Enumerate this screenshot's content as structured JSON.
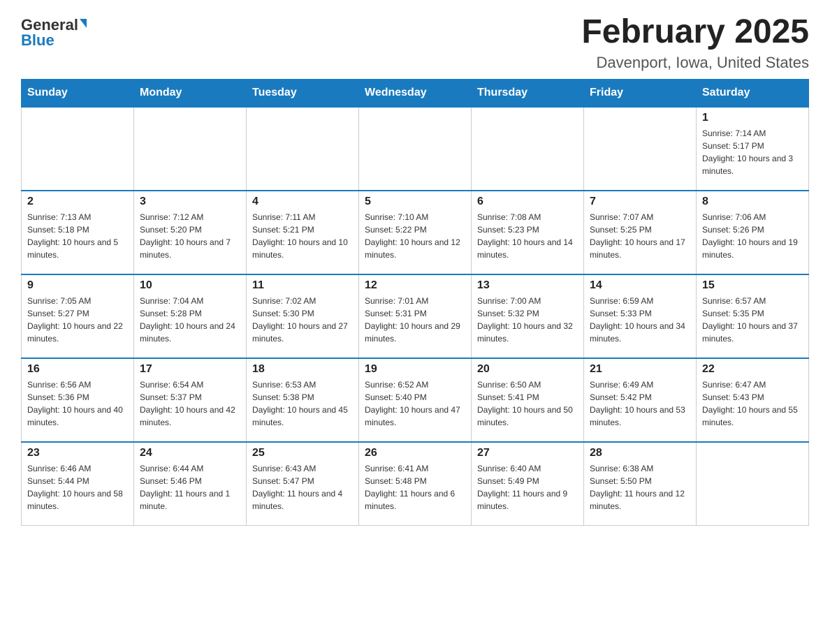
{
  "logo": {
    "general": "General",
    "blue": "Blue"
  },
  "title": "February 2025",
  "location": "Davenport, Iowa, United States",
  "days_of_week": [
    "Sunday",
    "Monday",
    "Tuesday",
    "Wednesday",
    "Thursday",
    "Friday",
    "Saturday"
  ],
  "weeks": [
    [
      {
        "day": "",
        "sunrise": "",
        "sunset": "",
        "daylight": ""
      },
      {
        "day": "",
        "sunrise": "",
        "sunset": "",
        "daylight": ""
      },
      {
        "day": "",
        "sunrise": "",
        "sunset": "",
        "daylight": ""
      },
      {
        "day": "",
        "sunrise": "",
        "sunset": "",
        "daylight": ""
      },
      {
        "day": "",
        "sunrise": "",
        "sunset": "",
        "daylight": ""
      },
      {
        "day": "",
        "sunrise": "",
        "sunset": "",
        "daylight": ""
      },
      {
        "day": "1",
        "sunrise": "Sunrise: 7:14 AM",
        "sunset": "Sunset: 5:17 PM",
        "daylight": "Daylight: 10 hours and 3 minutes."
      }
    ],
    [
      {
        "day": "2",
        "sunrise": "Sunrise: 7:13 AM",
        "sunset": "Sunset: 5:18 PM",
        "daylight": "Daylight: 10 hours and 5 minutes."
      },
      {
        "day": "3",
        "sunrise": "Sunrise: 7:12 AM",
        "sunset": "Sunset: 5:20 PM",
        "daylight": "Daylight: 10 hours and 7 minutes."
      },
      {
        "day": "4",
        "sunrise": "Sunrise: 7:11 AM",
        "sunset": "Sunset: 5:21 PM",
        "daylight": "Daylight: 10 hours and 10 minutes."
      },
      {
        "day": "5",
        "sunrise": "Sunrise: 7:10 AM",
        "sunset": "Sunset: 5:22 PM",
        "daylight": "Daylight: 10 hours and 12 minutes."
      },
      {
        "day": "6",
        "sunrise": "Sunrise: 7:08 AM",
        "sunset": "Sunset: 5:23 PM",
        "daylight": "Daylight: 10 hours and 14 minutes."
      },
      {
        "day": "7",
        "sunrise": "Sunrise: 7:07 AM",
        "sunset": "Sunset: 5:25 PM",
        "daylight": "Daylight: 10 hours and 17 minutes."
      },
      {
        "day": "8",
        "sunrise": "Sunrise: 7:06 AM",
        "sunset": "Sunset: 5:26 PM",
        "daylight": "Daylight: 10 hours and 19 minutes."
      }
    ],
    [
      {
        "day": "9",
        "sunrise": "Sunrise: 7:05 AM",
        "sunset": "Sunset: 5:27 PM",
        "daylight": "Daylight: 10 hours and 22 minutes."
      },
      {
        "day": "10",
        "sunrise": "Sunrise: 7:04 AM",
        "sunset": "Sunset: 5:28 PM",
        "daylight": "Daylight: 10 hours and 24 minutes."
      },
      {
        "day": "11",
        "sunrise": "Sunrise: 7:02 AM",
        "sunset": "Sunset: 5:30 PM",
        "daylight": "Daylight: 10 hours and 27 minutes."
      },
      {
        "day": "12",
        "sunrise": "Sunrise: 7:01 AM",
        "sunset": "Sunset: 5:31 PM",
        "daylight": "Daylight: 10 hours and 29 minutes."
      },
      {
        "day": "13",
        "sunrise": "Sunrise: 7:00 AM",
        "sunset": "Sunset: 5:32 PM",
        "daylight": "Daylight: 10 hours and 32 minutes."
      },
      {
        "day": "14",
        "sunrise": "Sunrise: 6:59 AM",
        "sunset": "Sunset: 5:33 PM",
        "daylight": "Daylight: 10 hours and 34 minutes."
      },
      {
        "day": "15",
        "sunrise": "Sunrise: 6:57 AM",
        "sunset": "Sunset: 5:35 PM",
        "daylight": "Daylight: 10 hours and 37 minutes."
      }
    ],
    [
      {
        "day": "16",
        "sunrise": "Sunrise: 6:56 AM",
        "sunset": "Sunset: 5:36 PM",
        "daylight": "Daylight: 10 hours and 40 minutes."
      },
      {
        "day": "17",
        "sunrise": "Sunrise: 6:54 AM",
        "sunset": "Sunset: 5:37 PM",
        "daylight": "Daylight: 10 hours and 42 minutes."
      },
      {
        "day": "18",
        "sunrise": "Sunrise: 6:53 AM",
        "sunset": "Sunset: 5:38 PM",
        "daylight": "Daylight: 10 hours and 45 minutes."
      },
      {
        "day": "19",
        "sunrise": "Sunrise: 6:52 AM",
        "sunset": "Sunset: 5:40 PM",
        "daylight": "Daylight: 10 hours and 47 minutes."
      },
      {
        "day": "20",
        "sunrise": "Sunrise: 6:50 AM",
        "sunset": "Sunset: 5:41 PM",
        "daylight": "Daylight: 10 hours and 50 minutes."
      },
      {
        "day": "21",
        "sunrise": "Sunrise: 6:49 AM",
        "sunset": "Sunset: 5:42 PM",
        "daylight": "Daylight: 10 hours and 53 minutes."
      },
      {
        "day": "22",
        "sunrise": "Sunrise: 6:47 AM",
        "sunset": "Sunset: 5:43 PM",
        "daylight": "Daylight: 10 hours and 55 minutes."
      }
    ],
    [
      {
        "day": "23",
        "sunrise": "Sunrise: 6:46 AM",
        "sunset": "Sunset: 5:44 PM",
        "daylight": "Daylight: 10 hours and 58 minutes."
      },
      {
        "day": "24",
        "sunrise": "Sunrise: 6:44 AM",
        "sunset": "Sunset: 5:46 PM",
        "daylight": "Daylight: 11 hours and 1 minute."
      },
      {
        "day": "25",
        "sunrise": "Sunrise: 6:43 AM",
        "sunset": "Sunset: 5:47 PM",
        "daylight": "Daylight: 11 hours and 4 minutes."
      },
      {
        "day": "26",
        "sunrise": "Sunrise: 6:41 AM",
        "sunset": "Sunset: 5:48 PM",
        "daylight": "Daylight: 11 hours and 6 minutes."
      },
      {
        "day": "27",
        "sunrise": "Sunrise: 6:40 AM",
        "sunset": "Sunset: 5:49 PM",
        "daylight": "Daylight: 11 hours and 9 minutes."
      },
      {
        "day": "28",
        "sunrise": "Sunrise: 6:38 AM",
        "sunset": "Sunset: 5:50 PM",
        "daylight": "Daylight: 11 hours and 12 minutes."
      },
      {
        "day": "",
        "sunrise": "",
        "sunset": "",
        "daylight": ""
      }
    ]
  ]
}
